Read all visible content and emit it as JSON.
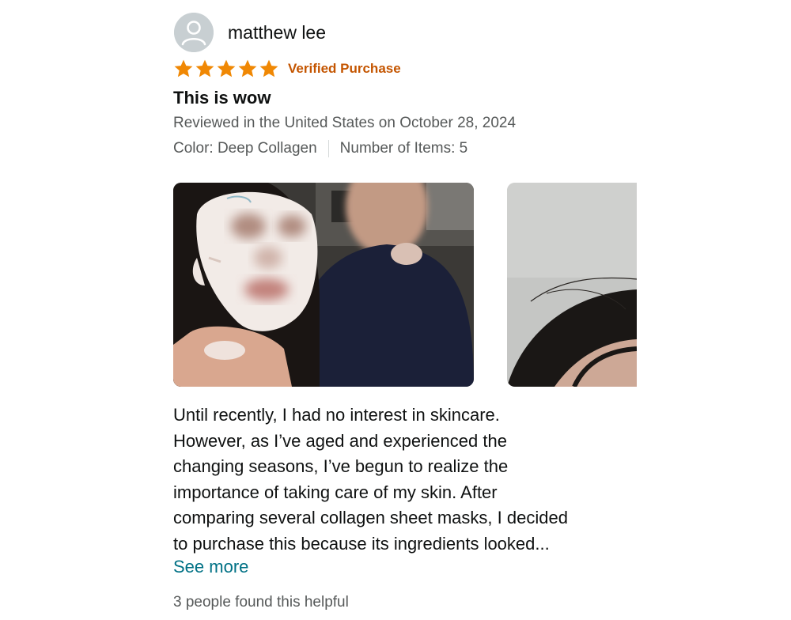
{
  "review": {
    "author": "matthew lee",
    "rating": 5,
    "rating_max": 5,
    "star_color": "#f08804",
    "verified_label": "Verified Purchase",
    "verified_color": "#c45500",
    "title": "This is wow",
    "reviewed_in": "Reviewed in the United States on October 28, 2024",
    "color_label": "Color: Deep Collagen",
    "items_label": "Number of Items: 5",
    "photos": [
      {
        "icon": "photo-couple-face-mask"
      },
      {
        "icon": "photo-hair-partial"
      }
    ],
    "body_lines": [
      "Until recently, I had no interest in skincare.",
      "However, as I’ve aged and experienced the",
      "changing seasons, I’ve begun to realize the",
      "importance of taking care of my skin. After",
      "comparing several collagen sheet masks, I decided",
      "to purchase this because its ingredients looked..."
    ],
    "see_more": "See more",
    "see_more_color": "#007185",
    "helpful_text": "3 people found this helpful"
  }
}
